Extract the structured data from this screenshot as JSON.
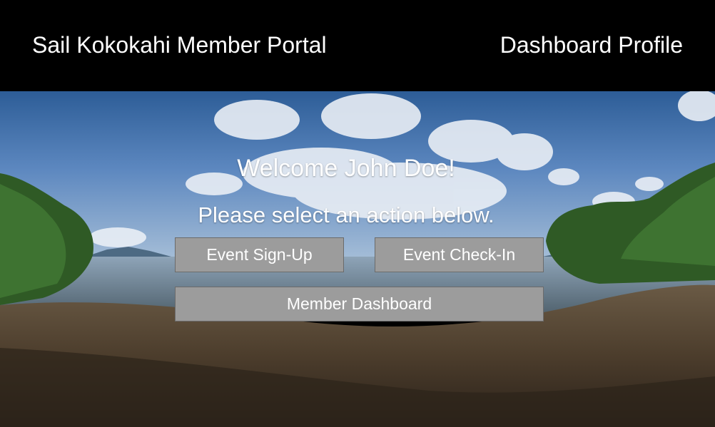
{
  "header": {
    "brand": "Sail Kokokahi Member Portal",
    "nav": {
      "dashboard": "Dashboard",
      "profile": "Profile"
    }
  },
  "main": {
    "welcome": "Welcome John Doe!",
    "prompt": "Please select an action below.",
    "actions": {
      "event_signup": "Event Sign-Up",
      "event_checkin": "Event Check-In",
      "member_dashboard": "Member Dashboard"
    }
  },
  "colors": {
    "header_bg": "#000000",
    "button_bg": "#9c9c9c",
    "text": "#ffffff"
  }
}
